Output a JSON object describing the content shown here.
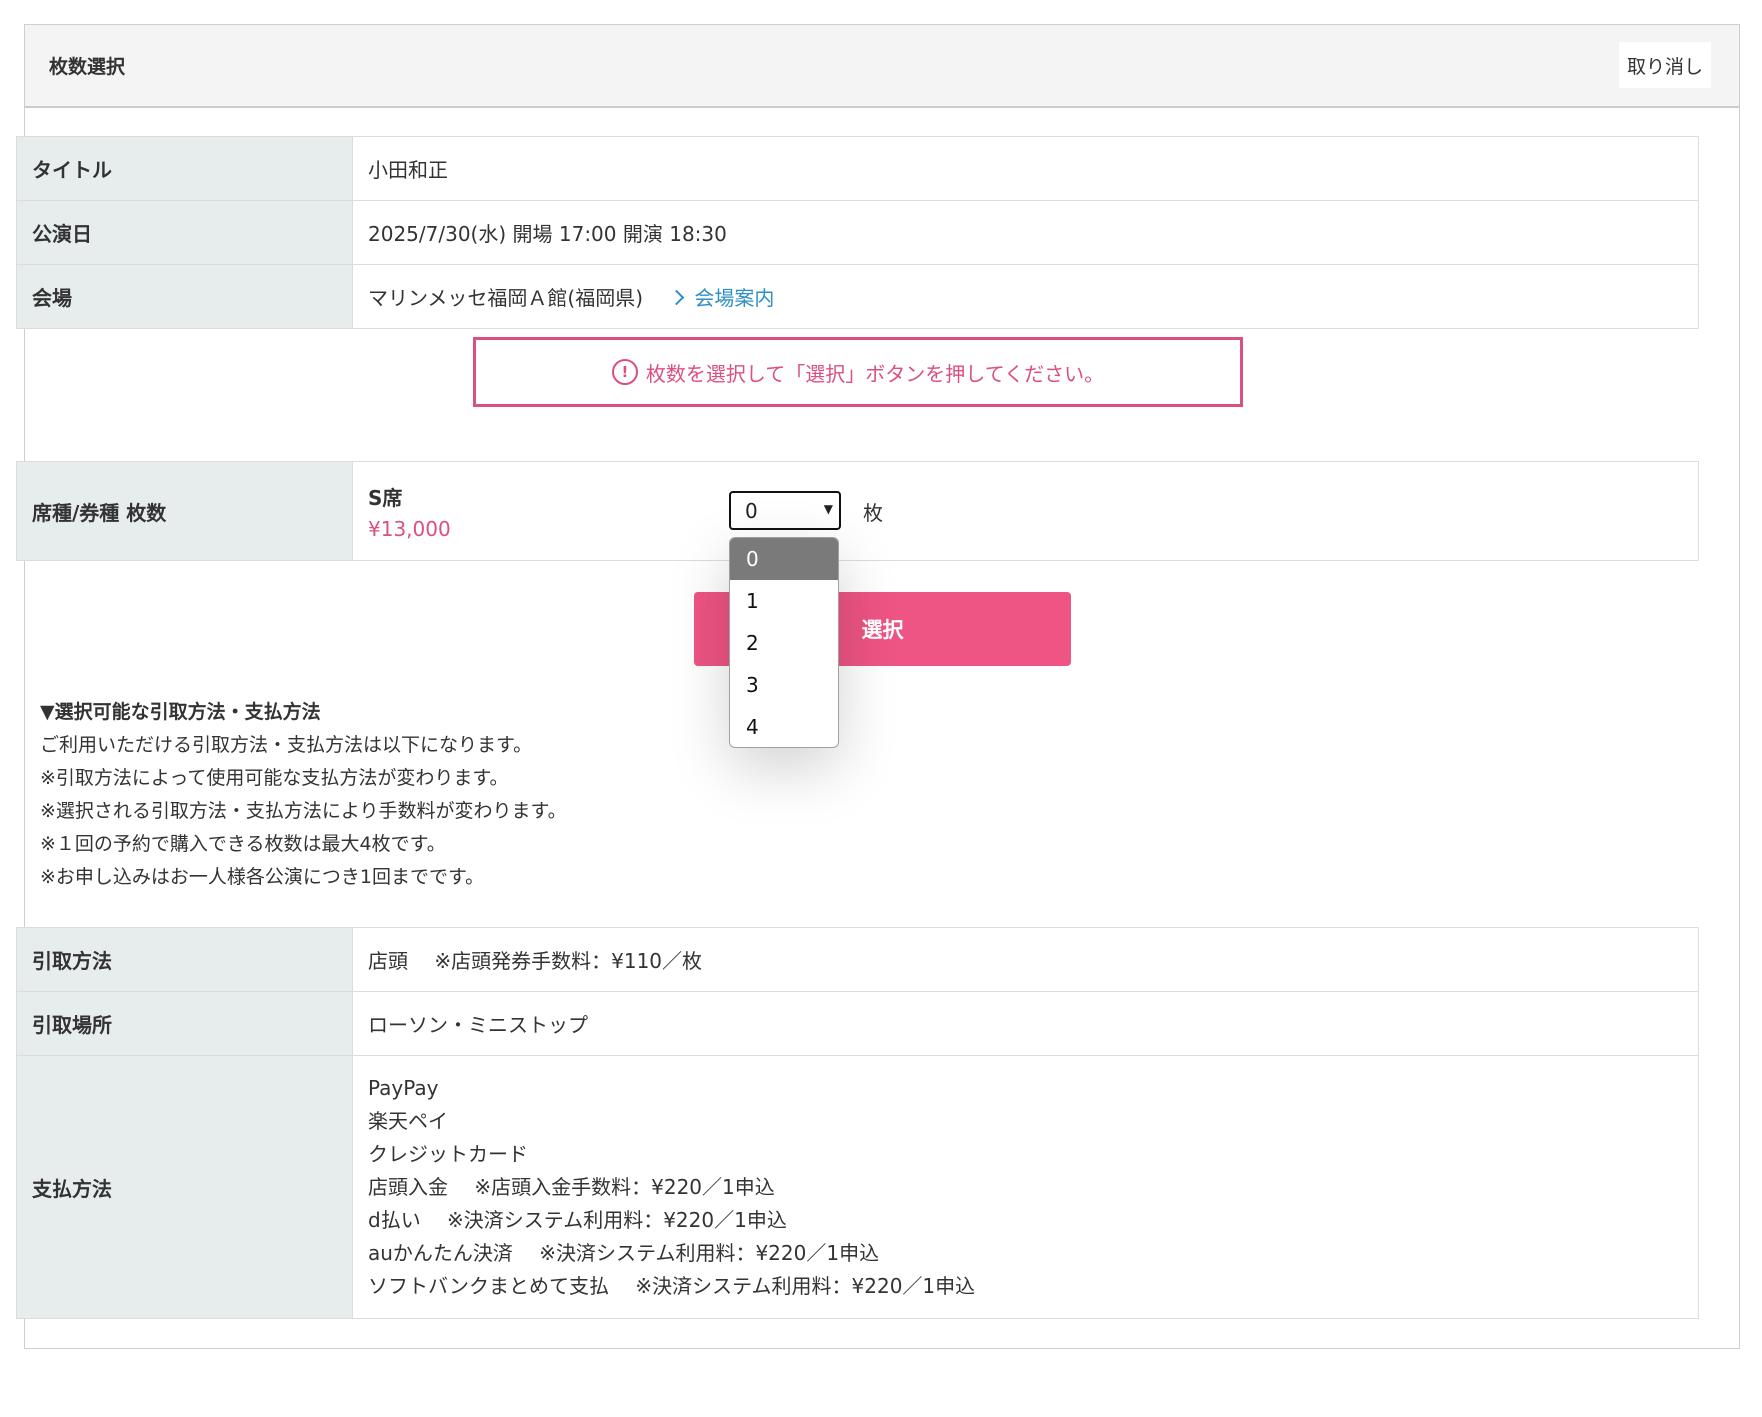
{
  "header": {
    "title": "枚数選択",
    "cancel_label": "取り消し"
  },
  "event_info": {
    "rows": [
      {
        "label": "タイトル",
        "value": "小田和正"
      },
      {
        "label": "公演日",
        "value": "2025/7/30(水) 開場 17:00 開演 18:30"
      },
      {
        "label": "会場",
        "value": "マリンメッセ福岡Ａ館(福岡県)",
        "link": "会場案内"
      }
    ]
  },
  "notice": {
    "text": "枚数を選択して「選択」ボタンを押してください。",
    "icon": "exclamation-circle-icon"
  },
  "quantity": {
    "label": "席種/券種 枚数",
    "seat_type": "S席",
    "price": "¥13,000",
    "selected": "0",
    "unit": "枚",
    "options": [
      "0",
      "1",
      "2",
      "3",
      "4"
    ]
  },
  "submit_label": "選択",
  "methods_info": {
    "heading": "▼選択可能な引取方法・支払方法",
    "lines": [
      "ご利用いただける引取方法・支払方法は以下になります。",
      "※引取方法によって使用可能な支払方法が変わります。",
      "※選択される引取方法・支払方法により手数料が変わります。",
      "※１回の予約で購入できる枚数は最大4枚です。",
      "※お申し込みはお一人様各公演につき1回までです。"
    ]
  },
  "delivery": {
    "method_label": "引取方法",
    "method_value": "店頭　 ※店頭発券手数料：¥110／枚",
    "place_label": "引取場所",
    "place_value": "ローソン・ミニストップ",
    "payment_label": "支払方法",
    "payment_methods": [
      "PayPay",
      "楽天ペイ",
      "クレジットカード",
      "店頭入金　 ※店頭入金手数料：¥220／1申込",
      "d払い　 ※決済システム利用料：¥220／1申込",
      "auかんたん決済　 ※決済システム利用料：¥220／1申込",
      "ソフトバンクまとめて支払　 ※決済システム利用料：¥220／1申込"
    ]
  },
  "colors": {
    "accent": "#ee5484",
    "notice": "#dc4f82",
    "link": "#2f8fc4",
    "label_bg": "#e7eded"
  }
}
